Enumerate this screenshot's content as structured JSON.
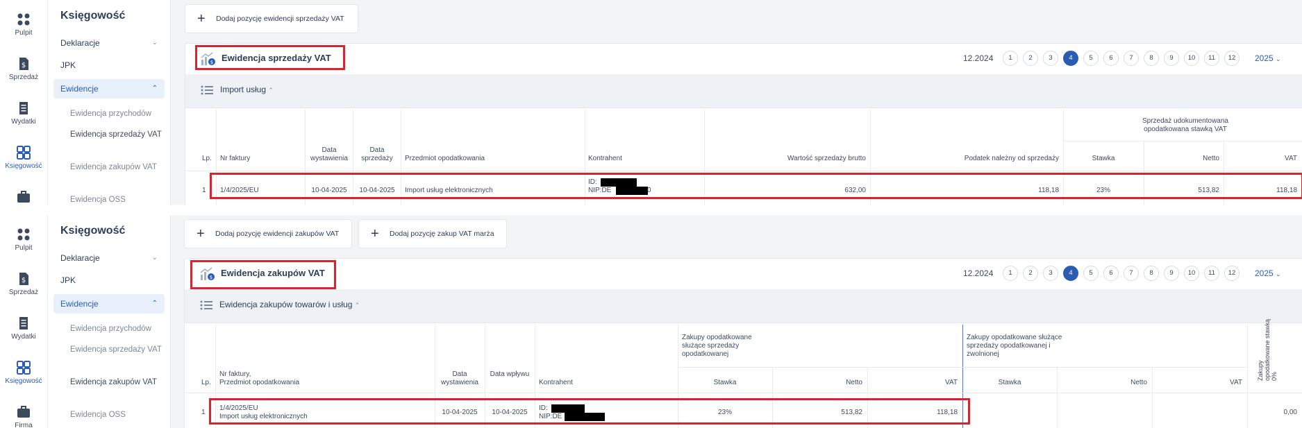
{
  "nav": {
    "rail": [
      {
        "label": "Pulpit",
        "icon": "dashboard-icon"
      },
      {
        "label": "Sprzedaż",
        "icon": "invoice-dollar-icon"
      },
      {
        "label": "Wydatki",
        "icon": "receipt-icon"
      },
      {
        "label": "Księgowość",
        "icon": "grid-icon"
      },
      {
        "label": "Firma",
        "icon": "briefcase-icon"
      }
    ],
    "section_title": "Księgowość",
    "menu": {
      "deklaracje": "Deklaracje",
      "jpk": "JPK",
      "ewidencje": "Ewidencje"
    },
    "submenu": {
      "przychodow": "Ewidencja przychodów",
      "sprzedazy": "Ewidencja sprzedaży VAT",
      "zakupow": "Ewidencja zakupów VAT",
      "oss": "Ewidencja OSS"
    }
  },
  "pagination": {
    "period": "12.2024",
    "months": [
      "1",
      "2",
      "3",
      "4",
      "5",
      "6",
      "7",
      "8",
      "9",
      "10",
      "11",
      "12"
    ],
    "active_month": "4",
    "year": "2025"
  },
  "sales": {
    "add_button": "Dodaj pozycję ewidencji sprzedaży VAT",
    "title": "Ewidencja sprzedaży VAT",
    "subsection": "Import usług",
    "columns": {
      "lp": "Lp.",
      "nr": "Nr faktury",
      "data_wyst": "Data wystawienia",
      "data_sprz": "Data sprzedaży",
      "przedmiot": "Przedmiot opodatkowania",
      "kontrahent": "Kontrahent",
      "brutto": "Wartość sprzedaży brutto",
      "podatek": "Podatek należny od sprzedaży",
      "group": "Sprzedaż udokumentowana opodatkowana stawką VAT",
      "stawka": "Stawka",
      "netto": "Netto",
      "vat": "VAT"
    },
    "row": {
      "lp": "1",
      "nr": "1/4/2025/EU",
      "data_wyst": "10-04-2025",
      "data_sprz": "10-04-2025",
      "przedmiot": "Import usług elektronicznych",
      "kontrahent_id": "ID:",
      "kontrahent_nip": "NIP:DE",
      "nip_tail": "0",
      "brutto": "632,00",
      "podatek": "118,18",
      "stawka": "23%",
      "netto": "513,82",
      "vat": "118,18"
    }
  },
  "purchases": {
    "add_button": "Dodaj pozycję ewidencji zakupów VAT",
    "add_margin_button": "Dodaj pozycję zakup VAT marża",
    "title": "Ewidencja zakupów VAT",
    "subsection": "Ewidencja zakupów towarów i usług",
    "columns": {
      "lp": "Lp.",
      "nr": "Nr faktury,",
      "nr2": "Przedmiot opodatkowania",
      "data_wyst": "Data wystawienia",
      "data_wpl": "Data wpływu",
      "kontrahent": "Kontrahent",
      "group1": "Zakupy opodatkowane służące sprzedaży opodatkowanej",
      "group2": "Zakupy opodatkowane służące sprzedaży opodatkowanej i zwolnionej",
      "stawka": "Stawka",
      "netto": "Netto",
      "vat": "VAT",
      "zero": "Zakupy opodatkowane stawką 0%"
    },
    "row": {
      "lp": "1",
      "nr": "1/4/2025/EU",
      "przedmiot": "Import usług elektronicznych",
      "data_wyst": "10-04-2025",
      "data_wpl": "10-04-2025",
      "kontrahent_id": "ID:",
      "kontrahent_nip": "NIP:DE",
      "stawka": "23%",
      "netto": "513,82",
      "vat": "118,18",
      "zero": "0,00"
    }
  }
}
